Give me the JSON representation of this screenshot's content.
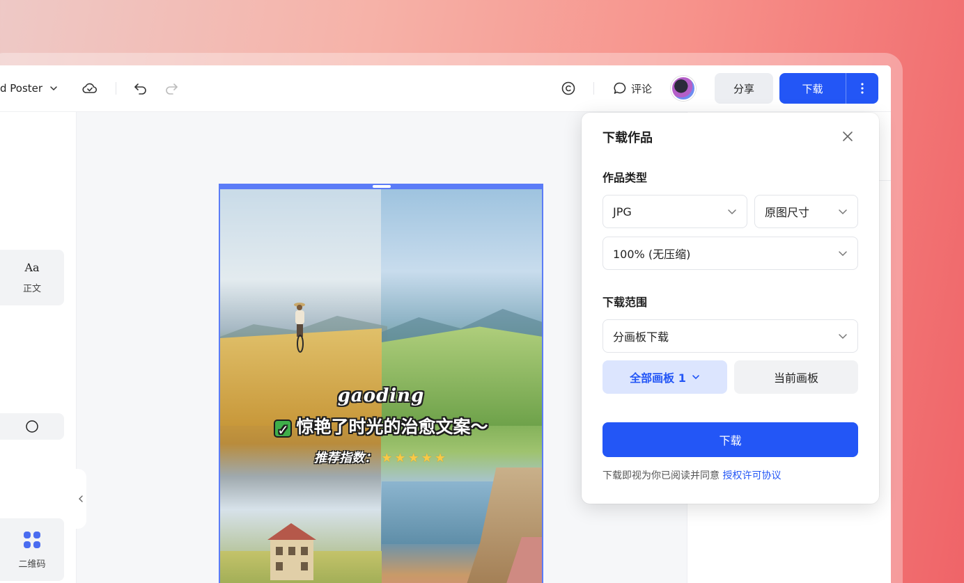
{
  "header": {
    "doc_title": "d Poster",
    "comment_label": "评论",
    "share_label": "分享",
    "download_label": "下载"
  },
  "left_panel": {
    "tools": [
      {
        "glyph": "Aa",
        "label": "正文"
      },
      {
        "glyph": "○",
        "label": ""
      },
      {
        "glyph": "",
        "label": "二维码"
      }
    ]
  },
  "poster": {
    "brand": "gaoding",
    "headline": "惊艳了时光的治愈文案～",
    "rating_label": "推荐指数：",
    "rating": 5
  },
  "download_dialog": {
    "title": "下载作品",
    "type_section": "作品类型",
    "format": "JPG",
    "size": "原图尺寸",
    "quality": "100% (无压缩)",
    "range_section": "下载范围",
    "range_mode": "分画板下载",
    "all_boards": "全部画板 1",
    "current_board": "当前画板",
    "download_button": "下载",
    "agreement_prefix": "下载即视为你已阅读并同意 ",
    "agreement_link": "授权许可协议"
  },
  "colors": {
    "primary": "#2356f6",
    "selected_tab_bg": "#dce5fe",
    "artboard_border": "#5b7cf7"
  }
}
